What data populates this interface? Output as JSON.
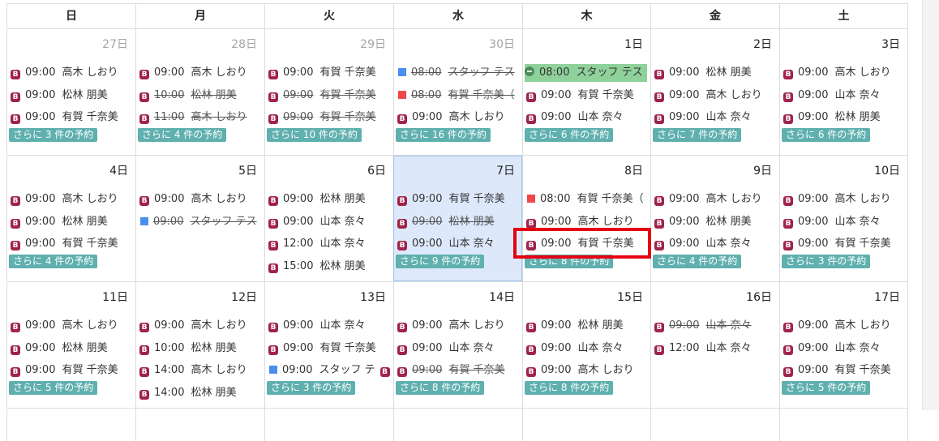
{
  "headers": [
    "日",
    "月",
    "火",
    "水",
    "木",
    "金",
    "土"
  ],
  "more_template": [
    "さらに ",
    " 件の予約"
  ],
  "weeks": [
    {
      "days": [
        {
          "label": "27日",
          "other": true,
          "events": [
            {
              "icon": "b",
              "time": "09:00",
              "name": "高木 しおり"
            },
            {
              "icon": "b",
              "time": "09:00",
              "name": "松林 朋美"
            },
            {
              "icon": "b",
              "time": "09:00",
              "name": "有賀 千奈美"
            }
          ],
          "more": "3"
        },
        {
          "label": "28日",
          "other": true,
          "events": [
            {
              "icon": "b",
              "time": "09:00",
              "name": "高木 しおり"
            },
            {
              "icon": "b",
              "time": "10:00",
              "name": "松林 朋美",
              "strike": true
            },
            {
              "icon": "b",
              "time": "11:00",
              "name": "高木 しおり",
              "strike": true
            }
          ],
          "more": "4"
        },
        {
          "label": "29日",
          "other": true,
          "events": [
            {
              "icon": "b",
              "time": "09:00",
              "name": "有賀 千奈美"
            },
            {
              "icon": "b",
              "time": "09:00",
              "name": "有賀 千奈美",
              "strike": true
            },
            {
              "icon": "b",
              "time": "09:00",
              "name": "有賀 千奈美",
              "strike": true
            }
          ],
          "more": "10"
        },
        {
          "label": "30日",
          "other": true,
          "events": [
            {
              "icon": "blue",
              "time": "08:00",
              "name": "スタッフ テス",
              "strike": true
            },
            {
              "icon": "red",
              "time": "08:00",
              "name": "有賀 千奈美（",
              "strike": true
            },
            {
              "icon": "b",
              "time": "09:00",
              "name": "高木 しおり"
            }
          ],
          "more": "16"
        },
        {
          "label": "1日",
          "events": [
            {
              "icon": "green",
              "time": "08:00",
              "name": "スタッフ テス",
              "green": true
            },
            {
              "icon": "b",
              "time": "09:00",
              "name": "有賀 千奈美"
            },
            {
              "icon": "b",
              "time": "09:00",
              "name": "山本 奈々"
            }
          ],
          "more": "6"
        },
        {
          "label": "2日",
          "events": [
            {
              "icon": "b",
              "time": "09:00",
              "name": "松林 朋美"
            },
            {
              "icon": "b",
              "time": "09:00",
              "name": "高木 しおり"
            },
            {
              "icon": "b",
              "time": "09:00",
              "name": "山本 奈々"
            }
          ],
          "more": "7"
        },
        {
          "label": "3日",
          "events": [
            {
              "icon": "b",
              "time": "09:00",
              "name": "高木 しおり"
            },
            {
              "icon": "b",
              "time": "09:00",
              "name": "山本 奈々"
            },
            {
              "icon": "b",
              "time": "09:00",
              "name": "松林 朋美"
            }
          ],
          "more": "6"
        }
      ]
    },
    {
      "days": [
        {
          "label": "4日",
          "events": [
            {
              "icon": "b",
              "time": "09:00",
              "name": "高木 しおり"
            },
            {
              "icon": "b",
              "time": "09:00",
              "name": "松林 朋美"
            },
            {
              "icon": "b",
              "time": "09:00",
              "name": "有賀 千奈美"
            }
          ],
          "more": "4"
        },
        {
          "label": "5日",
          "events": [
            {
              "icon": "b",
              "time": "09:00",
              "name": "高木 しおり"
            },
            {
              "icon": "blue",
              "time": "09:00",
              "name": "スタッフ テス",
              "strike": true
            }
          ]
        },
        {
          "label": "6日",
          "events": [
            {
              "icon": "b",
              "time": "09:00",
              "name": "松林 朋美"
            },
            {
              "icon": "b",
              "time": "09:00",
              "name": "山本 奈々"
            },
            {
              "icon": "b",
              "time": "12:00",
              "name": "山本 奈々"
            },
            {
              "icon": "b",
              "time": "15:00",
              "name": "松林 朋美"
            }
          ]
        },
        {
          "label": "7日",
          "today": true,
          "events": [
            {
              "icon": "b",
              "time": "09:00",
              "name": "有賀 千奈美"
            },
            {
              "icon": "b",
              "time": "09:00",
              "name": "松林 朋美",
              "strike": true
            },
            {
              "icon": "b",
              "time": "09:00",
              "name": "山本 奈々"
            }
          ],
          "more": "9"
        },
        {
          "label": "8日",
          "events": [
            {
              "icon": "red",
              "time": "08:00",
              "name": "有賀 千奈美（"
            },
            {
              "icon": "b",
              "time": "09:00",
              "name": "高木 しおり"
            },
            {
              "icon": "b",
              "time": "09:00",
              "name": "有賀 千奈美"
            }
          ],
          "more": "8"
        },
        {
          "label": "9日",
          "events": [
            {
              "icon": "b",
              "time": "09:00",
              "name": "高木 しおり"
            },
            {
              "icon": "b",
              "time": "09:00",
              "name": "松林 朋美"
            },
            {
              "icon": "b",
              "time": "09:00",
              "name": "山本 奈々"
            }
          ],
          "more": "4"
        },
        {
          "label": "10日",
          "events": [
            {
              "icon": "b",
              "time": "09:00",
              "name": "高木 しおり"
            },
            {
              "icon": "b",
              "time": "09:00",
              "name": "山本 奈々"
            },
            {
              "icon": "b",
              "time": "09:00",
              "name": "有賀 千奈美"
            }
          ],
          "more": "3"
        }
      ]
    },
    {
      "days": [
        {
          "label": "11日",
          "events": [
            {
              "icon": "b",
              "time": "09:00",
              "name": "高木 しおり"
            },
            {
              "icon": "b",
              "time": "09:00",
              "name": "松林 朋美"
            },
            {
              "icon": "b",
              "time": "09:00",
              "name": "有賀 千奈美"
            }
          ],
          "more": "5"
        },
        {
          "label": "12日",
          "events": [
            {
              "icon": "b",
              "time": "09:00",
              "name": "高木 しおり"
            },
            {
              "icon": "b",
              "time": "10:00",
              "name": "松林 朋美"
            },
            {
              "icon": "b",
              "time": "14:00",
              "name": "高木 しおり"
            },
            {
              "icon": "b",
              "time": "14:00",
              "name": "松林 朋美"
            }
          ]
        },
        {
          "label": "13日",
          "events": [
            {
              "icon": "b",
              "time": "09:00",
              "name": "山本 奈々"
            },
            {
              "icon": "b",
              "time": "09:00",
              "name": "有賀 千奈美"
            },
            {
              "icon": "blue",
              "time": "09:00",
              "name": "スタッフ テ",
              "trail": true
            }
          ],
          "more": "3"
        },
        {
          "label": "14日",
          "events": [
            {
              "icon": "b",
              "time": "09:00",
              "name": "高木 しおり"
            },
            {
              "icon": "b",
              "time": "09:00",
              "name": "山本 奈々"
            },
            {
              "icon": "b",
              "time": "09:00",
              "name": "有賀 千奈美",
              "strike": true
            }
          ],
          "more": "8"
        },
        {
          "label": "15日",
          "events": [
            {
              "icon": "b",
              "time": "09:00",
              "name": "松林 朋美"
            },
            {
              "icon": "b",
              "time": "09:00",
              "name": "山本 奈々"
            },
            {
              "icon": "b",
              "time": "09:00",
              "name": "高木 しおり"
            }
          ],
          "more": "8"
        },
        {
          "label": "16日",
          "events": [
            {
              "icon": "b",
              "time": "09:00",
              "name": "山本 奈々",
              "strike": true
            },
            {
              "icon": "b",
              "time": "12:00",
              "name": "山本 奈々"
            }
          ]
        },
        {
          "label": "17日",
          "events": [
            {
              "icon": "b",
              "time": "09:00",
              "name": "高木 しおり"
            },
            {
              "icon": "b",
              "time": "09:00",
              "name": "山本 奈々"
            },
            {
              "icon": "b",
              "time": "09:00",
              "name": "有賀 千奈美"
            }
          ],
          "more": "5"
        }
      ]
    }
  ]
}
